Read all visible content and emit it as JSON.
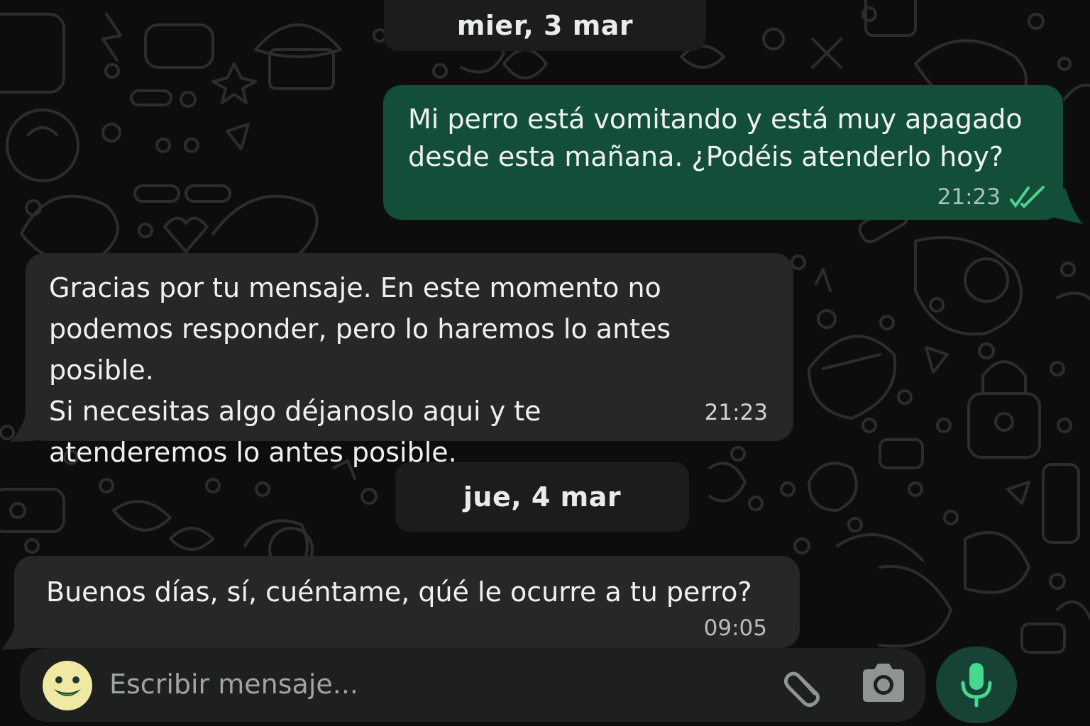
{
  "chat": {
    "dates": [
      "mier, 3 mar",
      "jue, 4 mar"
    ],
    "messages": [
      {
        "direction": "outgoing",
        "text": "Mi perro está vomitando y está muy apagado desde esta mañana. ¿Podéis atenderlo hoy?",
        "time": "21:23",
        "status": "read"
      },
      {
        "direction": "incoming",
        "text_lines": [
          "Gracias por tu mensaje. En este momento no",
          "podemos responder, pero lo haremos lo antes posible.",
          "Si necesitas algo déjanoslo aqui y te",
          "atenderemos lo antes posible."
        ],
        "time": "21:23"
      },
      {
        "direction": "incoming",
        "text": "Buenos días, sí, cuéntame, qúé le ocurre a tu perro?",
        "time": "09:05"
      }
    ]
  },
  "composer": {
    "placeholder": "Escribir mensaje...",
    "icons": {
      "emoji": "emoji-icon",
      "attach": "paperclip-icon",
      "camera": "camera-icon",
      "mic": "microphone-icon"
    }
  },
  "colors": {
    "background": "#0d0d0d",
    "outgoing_bubble": "#134e39",
    "incoming_bubble": "#262727",
    "read_ticks": "#4fd28f",
    "mic_button": "#174337"
  }
}
